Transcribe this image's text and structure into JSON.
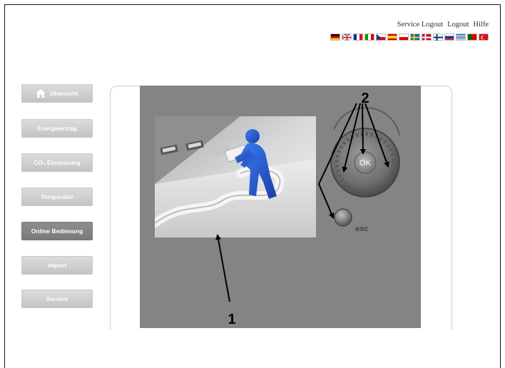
{
  "header": {
    "links": [
      "Service Logout",
      "Logout",
      "Hilfe"
    ],
    "flags": [
      "de",
      "gb",
      "fr",
      "it",
      "cz",
      "es",
      "pl",
      "se",
      "dk",
      "fi",
      "ru",
      "gr",
      "pt",
      "tr"
    ]
  },
  "sidebar": {
    "items": [
      {
        "label": "Übersicht",
        "icon": "home-icon"
      },
      {
        "label": "Energieertrag"
      },
      {
        "label": "CO₂ Einsparung"
      },
      {
        "label": "Temperatur"
      },
      {
        "label": "Online Bedienung",
        "active": true
      },
      {
        "label": "Import"
      },
      {
        "label": "Service"
      }
    ]
  },
  "device": {
    "ok_label": "OK",
    "esc_label": "esc"
  },
  "annotations": {
    "callout_1": "1",
    "callout_2": "2"
  },
  "colors": {
    "panel": "#858385",
    "button": "#d0d0d0",
    "button_active": "#848484",
    "figure_blue": "#2a63d8"
  }
}
